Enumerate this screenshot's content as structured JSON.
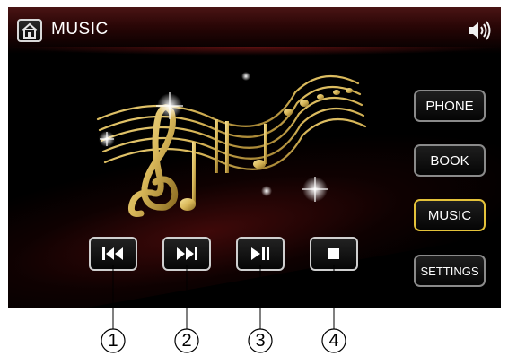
{
  "header": {
    "title": "MUSIC",
    "home_icon": "home-icon",
    "volume_icon": "speaker-volume-icon"
  },
  "artwork": {
    "icon": "music-notes-staff-icon"
  },
  "sidebar": {
    "items": [
      {
        "label": "PHONE",
        "active": false
      },
      {
        "label": "BOOK",
        "active": false
      },
      {
        "label": "MUSIC",
        "active": true
      },
      {
        "label": "SETTINGS",
        "active": false
      }
    ]
  },
  "controls": [
    {
      "icon": "previous-track-icon"
    },
    {
      "icon": "next-track-icon"
    },
    {
      "icon": "play-pause-icon"
    },
    {
      "icon": "stop-icon"
    }
  ],
  "callouts": [
    "1",
    "2",
    "3",
    "4"
  ],
  "colors": {
    "screen_bg": "#000000",
    "header_red": "#4a1414",
    "active_border": "#e4c23a",
    "button_border": "#8a8a8a",
    "gold": "#d9b85a"
  }
}
